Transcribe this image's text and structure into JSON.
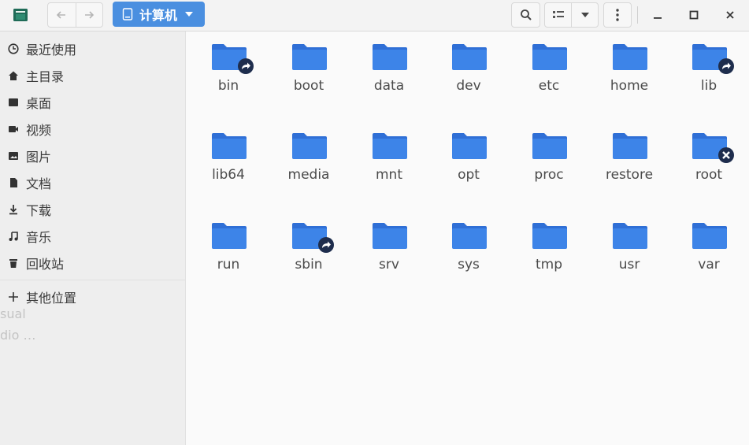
{
  "header": {
    "location_label": "计算机"
  },
  "sidebar": {
    "items": [
      {
        "label": "最近使用",
        "icon": "clock-icon"
      },
      {
        "label": "主目录",
        "icon": "home-icon"
      },
      {
        "label": "桌面",
        "icon": "desktop-icon"
      },
      {
        "label": "视频",
        "icon": "video-icon"
      },
      {
        "label": "图片",
        "icon": "picture-icon"
      },
      {
        "label": "文档",
        "icon": "document-icon"
      },
      {
        "label": "下载",
        "icon": "download-icon"
      },
      {
        "label": "音乐",
        "icon": "music-icon"
      },
      {
        "label": "回收站",
        "icon": "trash-icon"
      },
      {
        "label": "其他位置",
        "icon": "plus-icon"
      }
    ],
    "ghost_text": [
      "sual",
      "dio …"
    ]
  },
  "files": [
    {
      "name": "bin",
      "badge": "symlink"
    },
    {
      "name": "boot",
      "badge": ""
    },
    {
      "name": "data",
      "badge": ""
    },
    {
      "name": "dev",
      "badge": ""
    },
    {
      "name": "etc",
      "badge": ""
    },
    {
      "name": "home",
      "badge": ""
    },
    {
      "name": "lib",
      "badge": "symlink"
    },
    {
      "name": "lib64",
      "badge": ""
    },
    {
      "name": "media",
      "badge": ""
    },
    {
      "name": "mnt",
      "badge": ""
    },
    {
      "name": "opt",
      "badge": ""
    },
    {
      "name": "proc",
      "badge": ""
    },
    {
      "name": "restore",
      "badge": ""
    },
    {
      "name": "root",
      "badge": "no-access"
    },
    {
      "name": "run",
      "badge": ""
    },
    {
      "name": "sbin",
      "badge": "symlink"
    },
    {
      "name": "srv",
      "badge": ""
    },
    {
      "name": "sys",
      "badge": ""
    },
    {
      "name": "tmp",
      "badge": ""
    },
    {
      "name": "usr",
      "badge": ""
    },
    {
      "name": "var",
      "badge": ""
    }
  ],
  "colors": {
    "accent": "#4a8fe0",
    "folder": "#3d84e8",
    "folder_tab": "#2f6fd6",
    "badge": "#1e2d4d"
  }
}
